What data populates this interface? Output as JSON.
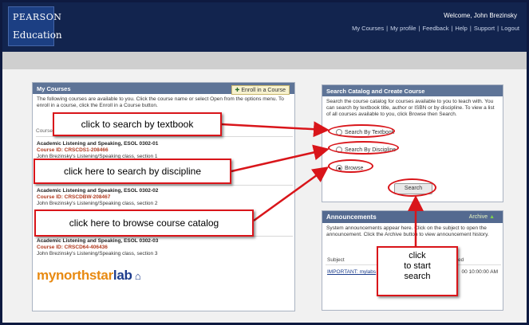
{
  "header": {
    "logo_brand": "PEARSON",
    "logo_sub": "Education",
    "welcome": "Welcome, John Brezinsky",
    "nav": [
      "My Courses",
      "My profile",
      "Feedback",
      "Help",
      "Support",
      "Logout"
    ]
  },
  "my_courses": {
    "title": "My Courses",
    "enroll_label": "Enroll in a Course",
    "intro": "The following courses are available to you. Click the course name or select Open from the options menu. To enroll in a course, click the Enroll in a Course button.",
    "column_header": "Course",
    "courses": [
      {
        "name": "Academic Listening and Speaking, ESOL 0302-01",
        "id": "Course ID: CRSCDS1-208466",
        "desc": "John Brezinsky's Listening/Speaking class, section 1"
      },
      {
        "name": "Academic Listening and Speaking, ESOL 0302-02",
        "id": "Course ID: CRSCDBW-208467",
        "desc": "John Brezinsky's Listening/Speaking class, section 2"
      },
      {
        "name": "Academic Listening and Speaking, ESOL 0302-03",
        "id": "Course ID: CRSCD64-406436",
        "desc": "John Brezinsky's Listening/Speaking class, section 3"
      }
    ],
    "logo_part1": "mynorthstar",
    "logo_part2": "lab"
  },
  "search_catalog": {
    "title": "Search Catalog and Create Course",
    "intro": "Search the course catalog for courses available to you to teach with. You can search by textbook title, author or ISBN or by discipline. To view a list of all courses available to you, click Browse then Search.",
    "options": [
      "Search By Textbook",
      "Search By Discipline",
      "Browse"
    ],
    "selected": "Browse",
    "button": "Search"
  },
  "announcements": {
    "title": "Announcements",
    "archive": "Archive",
    "intro": "System announcements appear here. Click on the subject to open the announcement. Click the Archive button to view announcement history.",
    "col_subject": "Subject",
    "col_posted": "ed",
    "link": "IMPORTANT: mylabs",
    "date": "00 10:00:00 AM"
  },
  "callouts": {
    "textbook": "click to search by textbook",
    "discipline": "click here to search by discipline",
    "browse": "click here to browse course catalog",
    "start": [
      "click",
      "to start",
      "search"
    ]
  },
  "colors": {
    "accent": "#d9151a",
    "header": "#12244e",
    "panel_head": "#5e7497"
  }
}
